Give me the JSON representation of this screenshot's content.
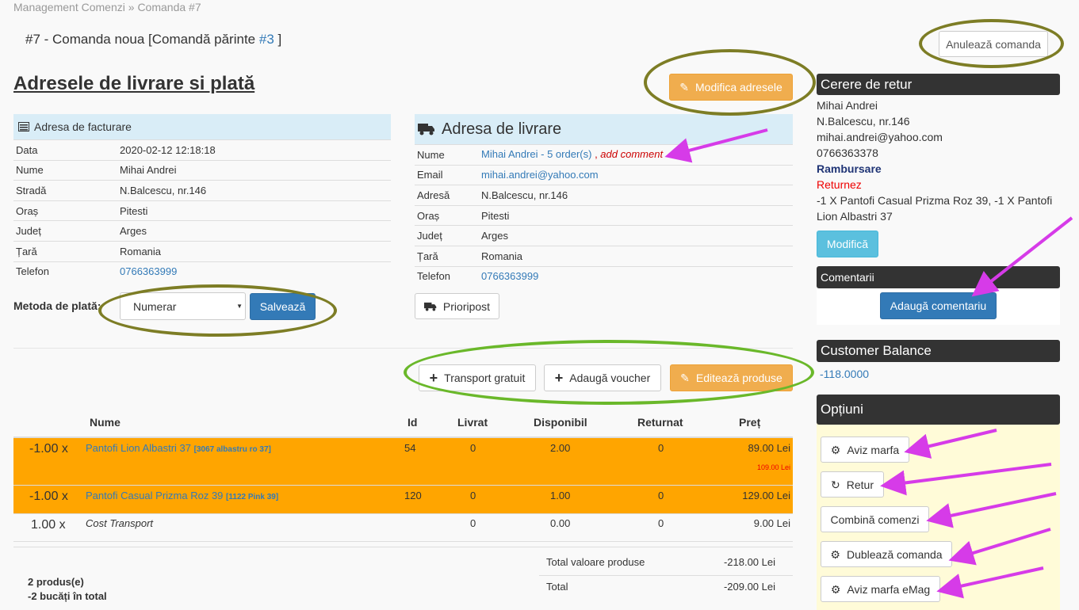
{
  "breadcrumb": {
    "root": "Management Comenzi",
    "separator": "»",
    "current": "Comanda #7"
  },
  "order_header": {
    "title": "#7 - Comanda noua [Comandă părinte ",
    "parent_link": "#3",
    "close_bracket": " ]",
    "cancel_button": "Anulează comanda"
  },
  "addresses": {
    "heading": "Adresele de livrare si plată",
    "modify_button": "Modifica adresele",
    "billing": {
      "title": "Adresa de facturare",
      "rows": [
        {
          "label": "Data",
          "value": "2020-02-12 12:18:18"
        },
        {
          "label": "Nume",
          "value": "Mihai Andrei"
        },
        {
          "label": "Stradă",
          "value": "N.Balcescu, nr.146"
        },
        {
          "label": "Oraș",
          "value": "Pitesti"
        },
        {
          "label": "Județ",
          "value": "Arges"
        },
        {
          "label": "Țară",
          "value": "Romania"
        },
        {
          "label": "Telefon",
          "value": "0766363999"
        }
      ]
    },
    "shipping": {
      "title": "Adresa de livrare",
      "name_link": "Mihai Andrei - 5 order(s)",
      "add_comment": "add comment",
      "rows": [
        {
          "label": "Nume",
          "value": ""
        },
        {
          "label": "Email",
          "value": "mihai.andrei@yahoo.com"
        },
        {
          "label": "Adresă",
          "value": "N.Balcescu, nr.146"
        },
        {
          "label": "Oraș",
          "value": "Pitesti"
        },
        {
          "label": "Județ",
          "value": "Arges"
        },
        {
          "label": "Țară",
          "value": "Romania"
        },
        {
          "label": "Telefon",
          "value": "0766363999"
        }
      ],
      "courier_button": "Prioripost"
    },
    "payment": {
      "label": "Metoda de plată:",
      "selected": "Numerar",
      "save_button": "Salvează"
    }
  },
  "products": {
    "actions": {
      "free_shipping": "Transport gratuit",
      "add_voucher": "Adaugă voucher",
      "edit_products": "Editează produse"
    },
    "columns": [
      "Nume",
      "Id",
      "Livrat",
      "Disponibil",
      "Returnat",
      "Preț"
    ],
    "rows": [
      {
        "qty": "-1.00 x",
        "name": "Pantofi Lion Albastri 37",
        "code": "[3067 albastru ro 37]",
        "id": "54",
        "delivered": "0",
        "available": "2.00",
        "returned": "0",
        "price": "89.00 Lei",
        "old_price": "109.00 Lei"
      },
      {
        "qty": "-1.00 x",
        "name": "Pantofi Casual Prizma Roz 39",
        "code": "[1122 Pink 39]",
        "id": "120",
        "delivered": "0",
        "available": "1.00",
        "returned": "0",
        "price": "129.00 Lei",
        "old_price": ""
      },
      {
        "qty": "1.00 x",
        "name": "Cost Transport",
        "code": "",
        "id": "",
        "delivered": "0",
        "available": "0.00",
        "returned": "0",
        "price": "9.00 Lei",
        "old_price": ""
      }
    ],
    "summary": {
      "count": "2 produs(e)",
      "pieces": "-2 bucăți în total",
      "total_products_label": "Total valoare produse",
      "total_products": "-218.00 Lei",
      "total_label": "Total",
      "total": "-209.00 Lei"
    }
  },
  "sidebar": {
    "return_request": {
      "title": "Cerere de retur",
      "name": "Mihai Andrei",
      "street": "N.Balcescu, nr.146",
      "email": "mihai.andrei@yahoo.com",
      "phone": "0766363378",
      "refund": "Rambursare",
      "return_label": "Returnez",
      "items": "-1 X Pantofi Casual Prizma Roz 39, -1 X Pantofi Lion Albastri 37",
      "modify_button": "Modifică"
    },
    "comments": {
      "title": "Comentarii",
      "add_button": "Adaugă comentariu"
    },
    "balance": {
      "title": "Customer Balance",
      "value": "-118.0000"
    },
    "options": {
      "title": "Opțiuni",
      "buttons": [
        {
          "label": "Aviz marfa",
          "icon": "gear-icon"
        },
        {
          "label": "Retur",
          "icon": "refresh-icon"
        },
        {
          "label": "Combină comenzi",
          "icon": ""
        },
        {
          "label": "Dublează comanda",
          "icon": "gear-icon"
        },
        {
          "label": "Aviz marfa eMag",
          "icon": "gear-icon"
        }
      ]
    }
  },
  "colors": {
    "highlight_row": "#ffa500",
    "annotation_olive": "#7d7d25",
    "annotation_green": "#6ab82a",
    "annotation_arrow": "#d63be8"
  }
}
